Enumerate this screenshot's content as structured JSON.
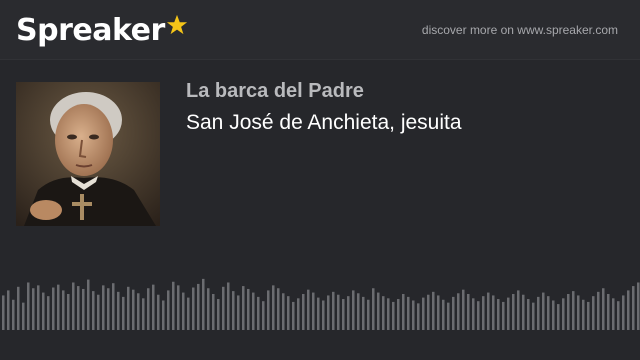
{
  "brand": {
    "name": "Spreaker",
    "star_color": "#f5c518"
  },
  "header": {
    "discover_text": "discover more on www.spreaker.com"
  },
  "episode": {
    "show_title": "La barca del Padre",
    "title": "San José de Anchieta, jesuita",
    "cover_icon": "portrait-jesuit-priest"
  },
  "waveform": {
    "bar_color": "#6b6c70",
    "levels": [
      0.48,
      0.55,
      0.42,
      0.6,
      0.38,
      0.66,
      0.58,
      0.62,
      0.52,
      0.47,
      0.59,
      0.63,
      0.55,
      0.5,
      0.66,
      0.61,
      0.57,
      0.7,
      0.54,
      0.49,
      0.62,
      0.58,
      0.65,
      0.53,
      0.46,
      0.6,
      0.56,
      0.51,
      0.44,
      0.58,
      0.63,
      0.49,
      0.41,
      0.55,
      0.67,
      0.62,
      0.52,
      0.45,
      0.59,
      0.64,
      0.71,
      0.58,
      0.5,
      0.43,
      0.6,
      0.66,
      0.54,
      0.48,
      0.61,
      0.57,
      0.52,
      0.46,
      0.4,
      0.55,
      0.62,
      0.58,
      0.51,
      0.47,
      0.39,
      0.44,
      0.5,
      0.56,
      0.52,
      0.45,
      0.41,
      0.48,
      0.53,
      0.49,
      0.43,
      0.47,
      0.55,
      0.51,
      0.46,
      0.42,
      0.58,
      0.52,
      0.47,
      0.44,
      0.39,
      0.43,
      0.5,
      0.46,
      0.41,
      0.37,
      0.45,
      0.49,
      0.53,
      0.48,
      0.42,
      0.38,
      0.46,
      0.51,
      0.56,
      0.5,
      0.44,
      0.4,
      0.47,
      0.52,
      0.48,
      0.43,
      0.39,
      0.45,
      0.5,
      0.55,
      0.49,
      0.43,
      0.38,
      0.46,
      0.52,
      0.47,
      0.41,
      0.36,
      0.44,
      0.5,
      0.54,
      0.48,
      0.42,
      0.39,
      0.47,
      0.53,
      0.58,
      0.5,
      0.44,
      0.4,
      0.48,
      0.55,
      0.61,
      0.66,
      0.57
    ]
  }
}
